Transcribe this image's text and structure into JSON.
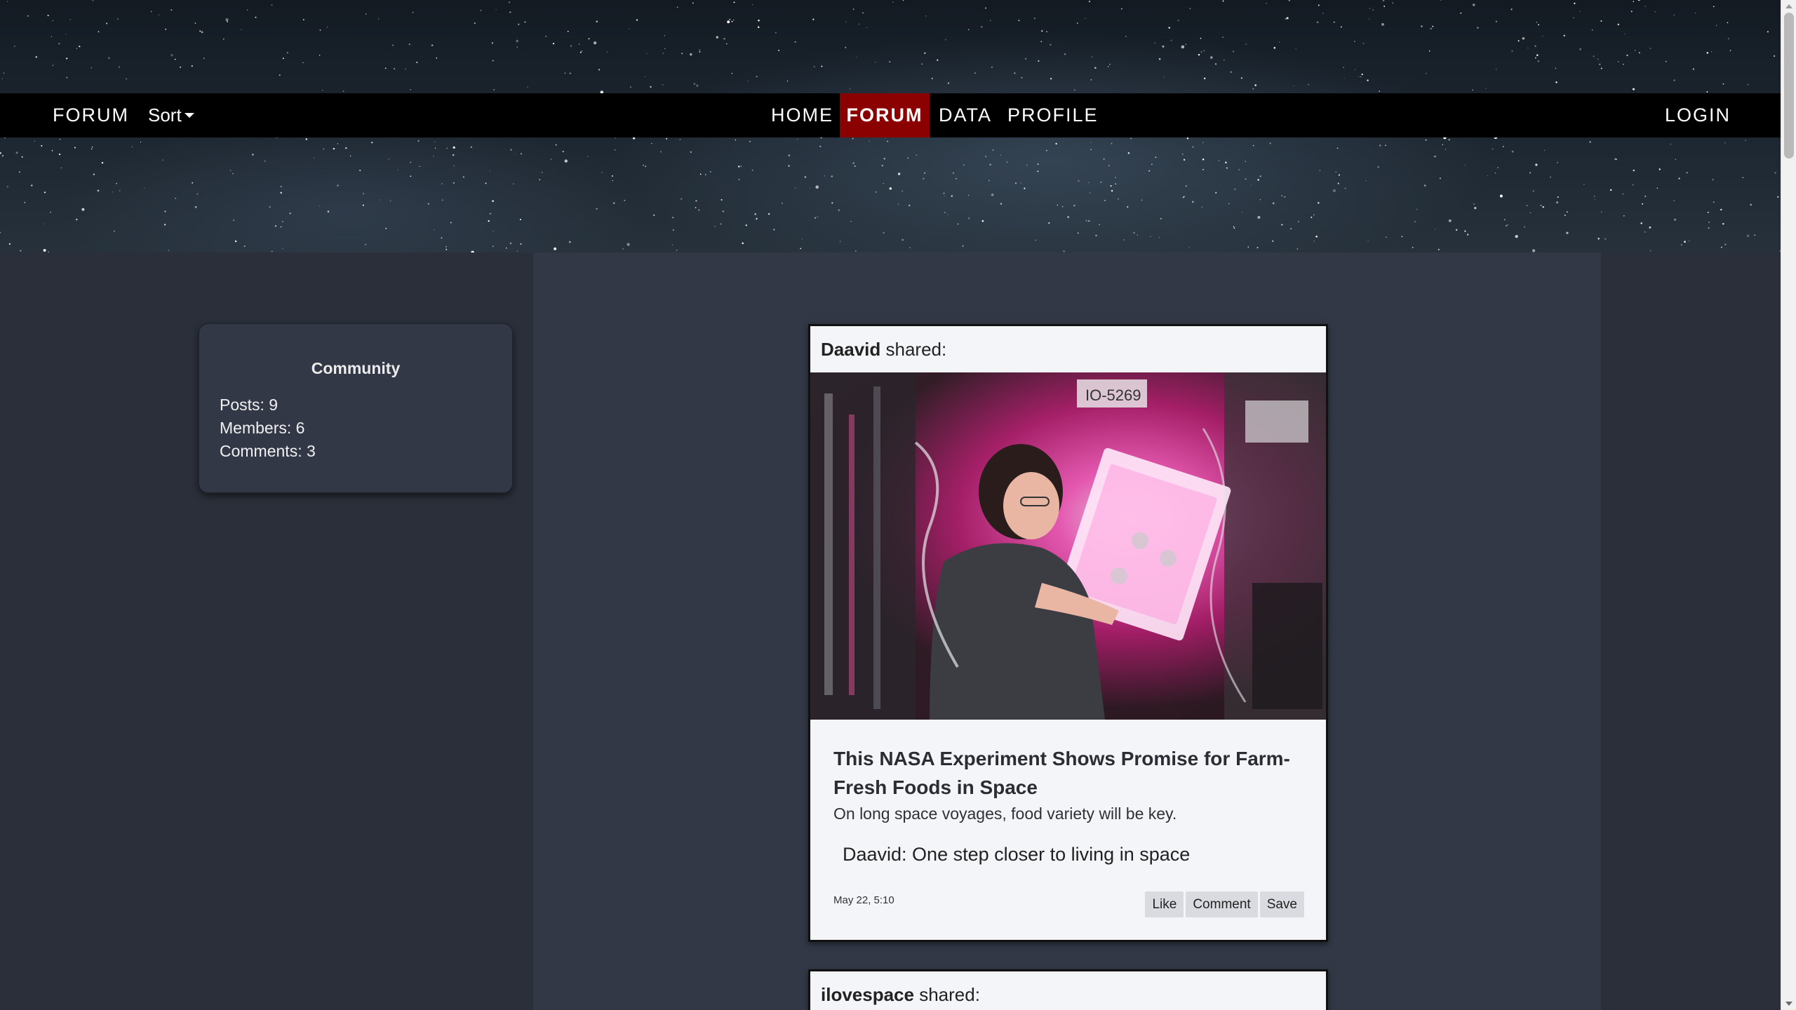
{
  "navbar": {
    "brand": "FORUM",
    "sort_label": "Sort",
    "links": [
      "HOME",
      "FORUM",
      "DATA",
      "PROFILE"
    ],
    "active_link": "FORUM",
    "login": "LOGIN",
    "active_color": "#8b0000"
  },
  "community": {
    "title": "Community",
    "posts": "Posts: 9",
    "members": "Members: 6",
    "comments": "Comments: 3"
  },
  "posts": [
    {
      "author": "Daavid",
      "shared_suffix": "shared:",
      "image_alt": "astronaut tending plants in pink-lit growth chamber on space station",
      "title": "This NASA Experiment Shows Promise for Farm-Fresh Foods in Space",
      "subtitle": "On long space voyages, food variety will be key.",
      "comment": "Daavid: One step closer to living in space",
      "date": "May 22, 5:10",
      "actions": [
        "Like",
        "Comment",
        "Save"
      ]
    },
    {
      "author": "ilovespace",
      "shared_suffix": "shared:"
    }
  ]
}
